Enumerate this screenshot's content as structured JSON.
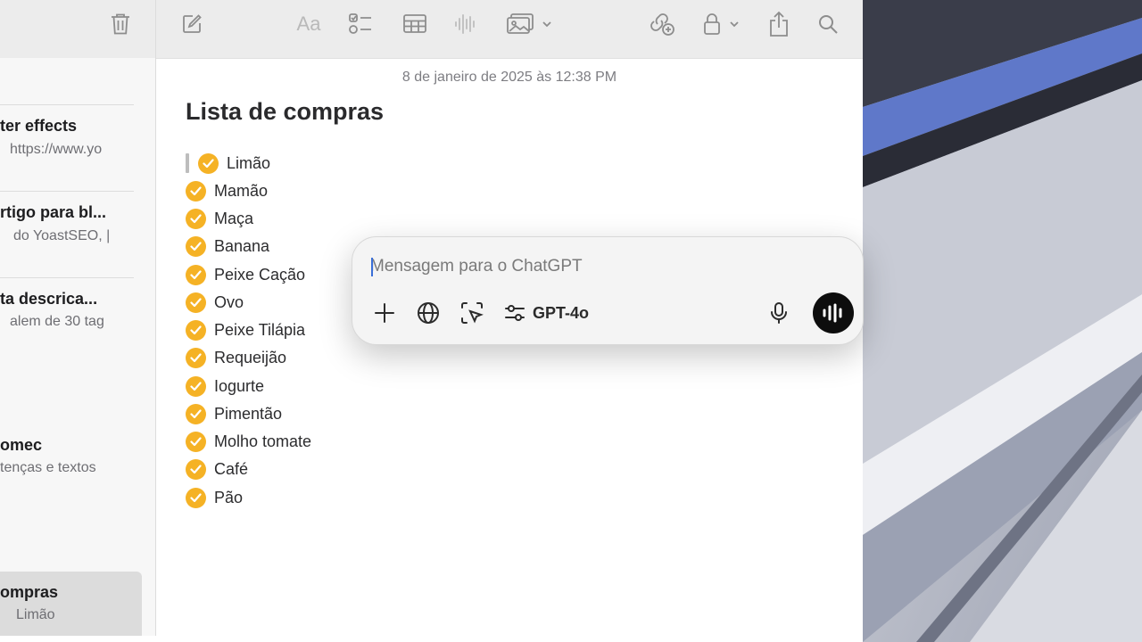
{
  "note": {
    "date": "8 de janeiro de 2025 às 12:38 PM",
    "title": "Lista de compras",
    "items": [
      "Limão",
      "Mamão",
      "Maça",
      "Banana",
      "Peixe Cação",
      "Ovo",
      "Peixe Tilápia",
      "Requeijão",
      "Iogurte",
      "Pimentão",
      "Molho tomate",
      "Café",
      "Pão"
    ]
  },
  "sidebar": {
    "notes": [
      {
        "title": "ter effects",
        "subtitle": "https://www.yo"
      },
      {
        "title": "rtigo para bl...",
        "subtitle": "do YoastSEO, |"
      },
      {
        "title": "ta descrica...",
        "subtitle": "alem de 30 tag"
      },
      {
        "title": "omec",
        "subtitle": "tenças e textos"
      },
      {
        "title": "ompras",
        "subtitle": "Limão"
      }
    ]
  },
  "toolbar": {
    "format_label": "Aa",
    "icons": [
      "trash-icon",
      "compose-icon",
      "format-icon",
      "checklist-icon",
      "table-icon",
      "audio-icon",
      "media-icon",
      "collaborate-icon",
      "lock-icon",
      "share-icon",
      "search-icon"
    ]
  },
  "chat": {
    "placeholder": "Mensagem para o ChatGPT",
    "model": "GPT-4o"
  },
  "colors": {
    "check": "#f5b225",
    "caret": "#3a6fd8",
    "voice_button": "#0d0d0d"
  }
}
